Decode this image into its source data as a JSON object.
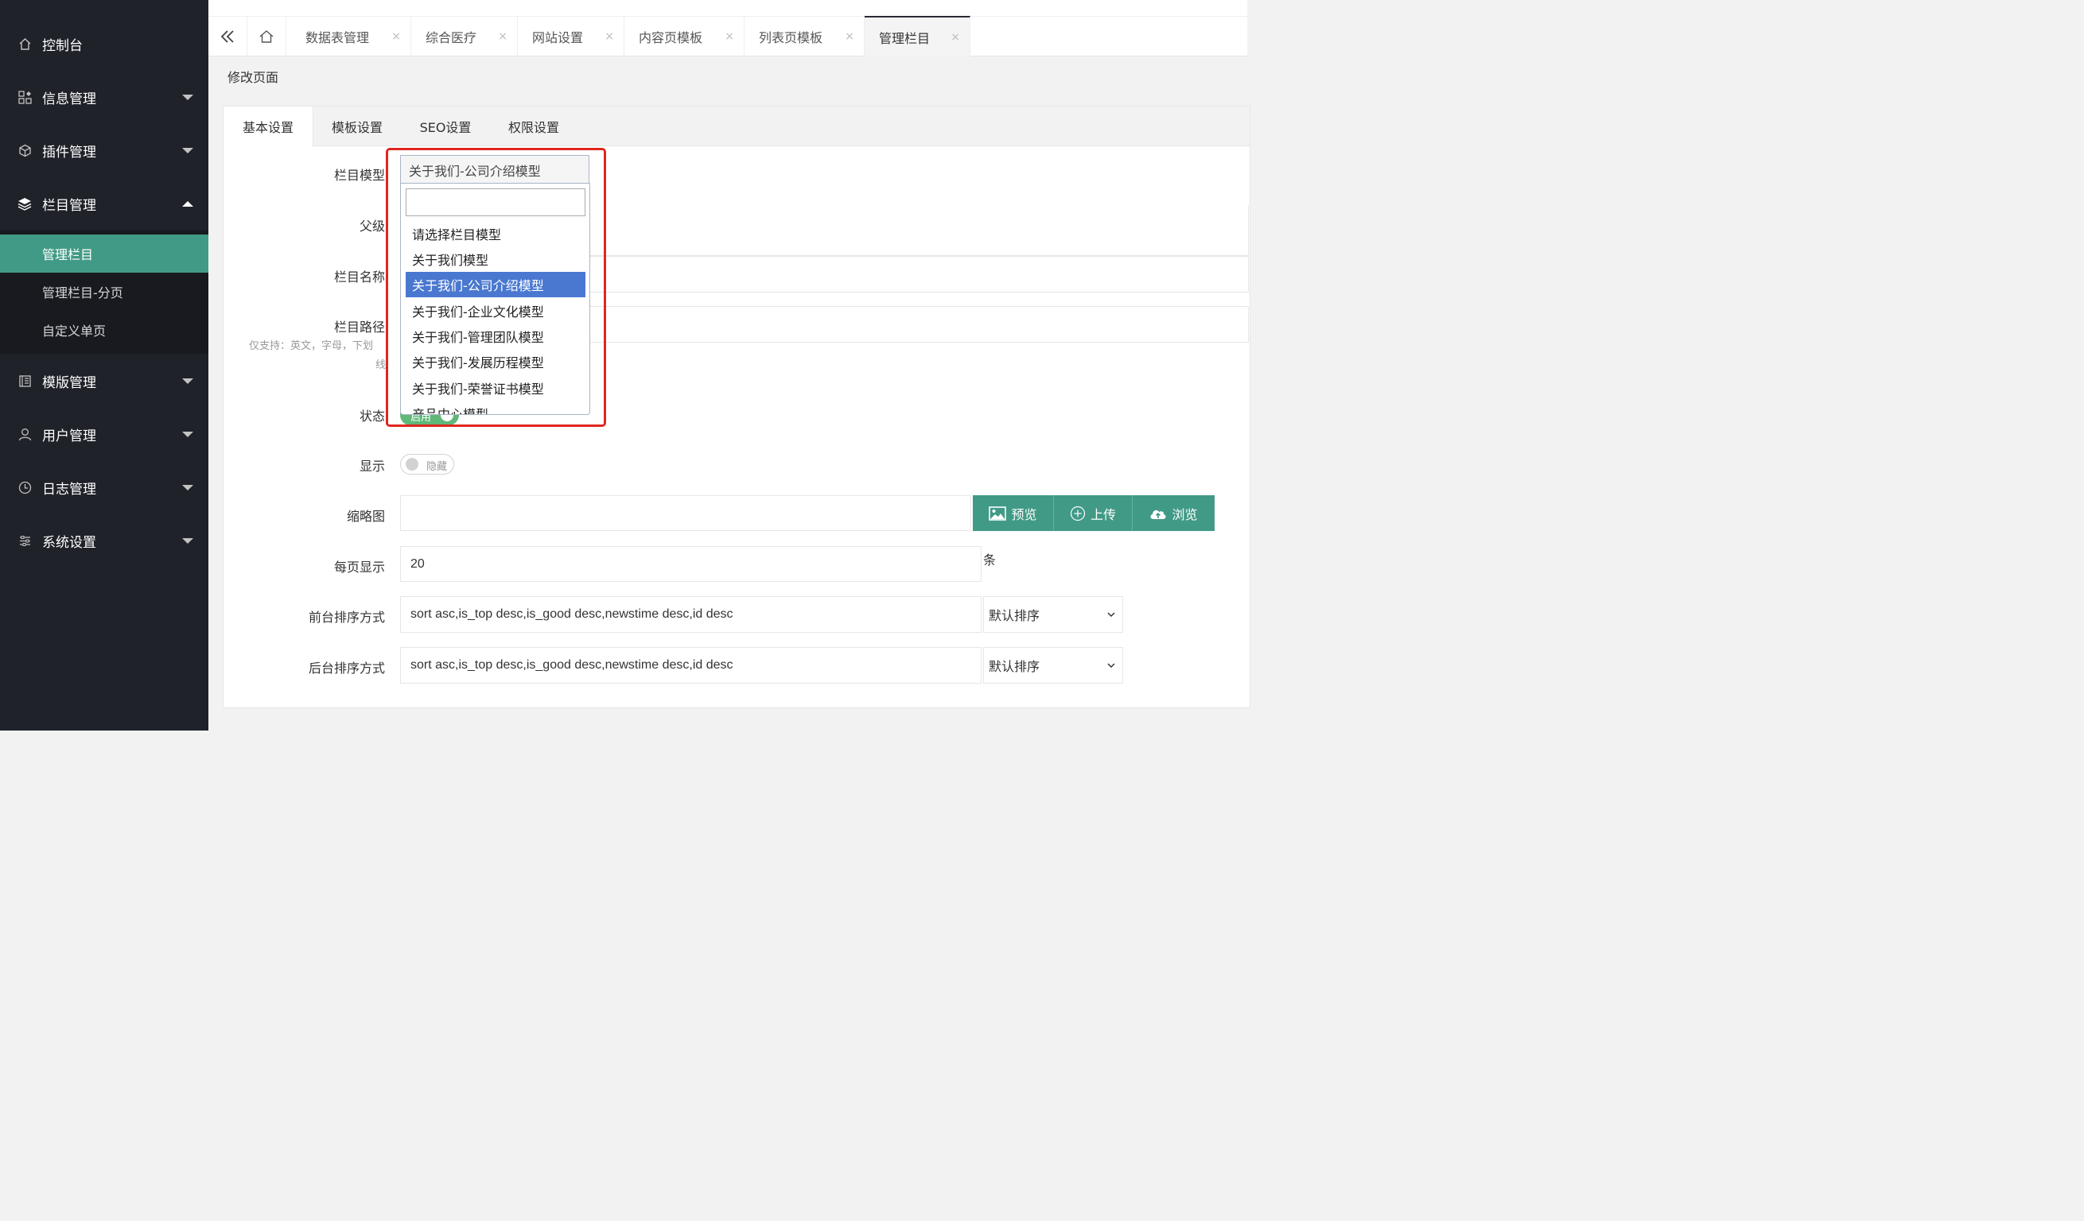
{
  "sidebar": {
    "items": [
      {
        "label": "控制台",
        "icon": "home-icon"
      },
      {
        "label": "信息管理",
        "icon": "apps-icon"
      },
      {
        "label": "插件管理",
        "icon": "cube-icon"
      },
      {
        "label": "栏目管理",
        "icon": "layers-icon"
      },
      {
        "label": "模版管理",
        "icon": "template-icon"
      },
      {
        "label": "用户管理",
        "icon": "user-icon"
      },
      {
        "label": "日志管理",
        "icon": "clock-icon"
      },
      {
        "label": "系统设置",
        "icon": "sliders-icon"
      }
    ],
    "sub_items": [
      {
        "label": "管理栏目"
      },
      {
        "label": "管理栏目-分页"
      },
      {
        "label": "自定义单页"
      }
    ]
  },
  "tabs": [
    {
      "label": "数据表管理"
    },
    {
      "label": "综合医疗"
    },
    {
      "label": "网站设置"
    },
    {
      "label": "内容页模板"
    },
    {
      "label": "列表页模板"
    },
    {
      "label": "管理栏目"
    }
  ],
  "tab_close": "×",
  "page": {
    "title": "修改页面"
  },
  "form_tabs": [
    {
      "label": "基本设置"
    },
    {
      "label": "模板设置"
    },
    {
      "label": "SEO设置"
    },
    {
      "label": "权限设置"
    }
  ],
  "form": {
    "model_label": "栏目模型",
    "parent_label": "父级",
    "name_label": "栏目名称",
    "path_label": "栏目路径",
    "path_hint_line1": "仅支持：英文，字母，下划",
    "path_hint_line2": "线",
    "status_label": "状态",
    "status_value": "启用",
    "display_label": "显示",
    "display_value": "隐藏",
    "thumb_label": "缩略图",
    "preview_btn": "预览",
    "upload_btn": "上传",
    "browse_btn": "浏览",
    "perpage_label": "每页显示",
    "perpage_value": "20",
    "perpage_unit": "条",
    "front_sort_label": "前台排序方式",
    "front_sort_value": "sort asc,is_top desc,is_good desc,newstime desc,id desc",
    "front_sort_select": "默认排序",
    "back_sort_label": "后台排序方式",
    "back_sort_value": "sort asc,is_top desc,is_good desc,newstime desc,id desc",
    "back_sort_select": "默认排序"
  },
  "dropdown": {
    "selected": "关于我们-公司介绍模型",
    "search_value": "",
    "options": [
      "请选择栏目模型",
      "关于我们模型",
      "关于我们-公司介绍模型",
      "关于我们-企业文化模型",
      "关于我们-管理团队模型",
      "关于我们-发展历程模型",
      "关于我们-荣誉证书模型",
      "产品中心模型"
    ]
  },
  "colors": {
    "sidebar_bg": "#20222a",
    "accent_green": "#419a86",
    "dropdown_highlight": "#4a78d0",
    "annotation_red": "#e0261f"
  }
}
